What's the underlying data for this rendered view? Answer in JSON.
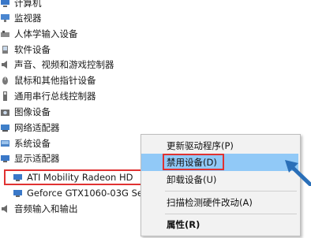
{
  "tree": {
    "categories": [
      {
        "label": "计算机",
        "icon": "computer-icon"
      },
      {
        "label": "监视器",
        "icon": "monitor-icon"
      },
      {
        "label": "人体学输入设备",
        "icon": "hid-icon"
      },
      {
        "label": "软件设备",
        "icon": "software-device-icon"
      },
      {
        "label": "声音、视频和游戏控制器",
        "icon": "speaker-icon"
      },
      {
        "label": "鼠标和其他指针设备",
        "icon": "mouse-icon"
      },
      {
        "label": "通用串行总线控制器",
        "icon": "usb-icon"
      },
      {
        "label": "图像设备",
        "icon": "camera-icon"
      },
      {
        "label": "网络适配器",
        "icon": "network-icon"
      },
      {
        "label": "系统设备",
        "icon": "system-device-icon"
      },
      {
        "label": "显示适配器",
        "icon": "display-adapter-icon"
      }
    ],
    "display_adapters": [
      {
        "label": "ATI Mobility Radeon HD",
        "icon": "gpu-icon"
      },
      {
        "label": "Geforce GTX1060-03G Se",
        "icon": "gpu-icon"
      }
    ],
    "after": [
      {
        "label": "音频输入和输出",
        "icon": "audio-io-icon"
      }
    ]
  },
  "context_menu": {
    "items": [
      {
        "label": "更新驱动程序(P)"
      },
      {
        "label": "禁用设备(D)"
      },
      {
        "label": "卸载设备(U)"
      },
      {
        "label": "扫描检测硬件改动(A)"
      },
      {
        "label": "属性(R)"
      }
    ]
  },
  "colors": {
    "highlight_border": "#e03232",
    "menu_hover": "#91c9f7",
    "arrow": "#2a6fb8"
  }
}
